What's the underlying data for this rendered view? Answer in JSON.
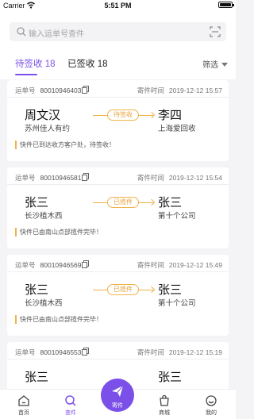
{
  "status_bar": {
    "carrier": "Carrier",
    "time": "5:51 PM"
  },
  "search": {
    "placeholder": "输入运单号查件"
  },
  "tabs": [
    {
      "label": "待签收 18",
      "active": true
    },
    {
      "label": "已签收 18",
      "active": false
    }
  ],
  "filter_label": "筛选",
  "labels": {
    "order": "运单号",
    "send_time": "寄件时间"
  },
  "cards": [
    {
      "order_no": "80010946403",
      "time": "2019-12-12 15:57",
      "sender_name": "周文汉",
      "sender_addr": "苏州佳人有约",
      "receiver_name": "李四",
      "receiver_addr": "上海爱回收",
      "status": "待签收",
      "note": "快件已到达收方客户处，待签收！"
    },
    {
      "order_no": "80010946581",
      "time": "2019-12-12 15:54",
      "sender_name": "张三",
      "sender_addr": "长沙植木西",
      "receiver_name": "张三",
      "receiver_addr": "第十个公司",
      "status": "已揽件",
      "note": "快件已由南山点部揽件完毕！"
    },
    {
      "order_no": "80010946569",
      "time": "2019-12-12 15:49",
      "sender_name": "张三",
      "sender_addr": "长沙植木西",
      "receiver_name": "张三",
      "receiver_addr": "第十个公司",
      "status": "已揽件",
      "note": "快件已由南山点部揽件完毕！"
    },
    {
      "order_no": "80010946553",
      "time": "2019-12-12 15:19",
      "sender_name": "张三",
      "sender_addr": "",
      "receiver_name": "张三",
      "receiver_addr": "",
      "status": "",
      "note": ""
    }
  ],
  "tabbar": {
    "home": "首页",
    "query": "查件",
    "send": "寄件",
    "mall": "商城",
    "mine": "我的"
  },
  "colors": {
    "accent": "#7b50e8",
    "badge": "#f0b24a"
  }
}
